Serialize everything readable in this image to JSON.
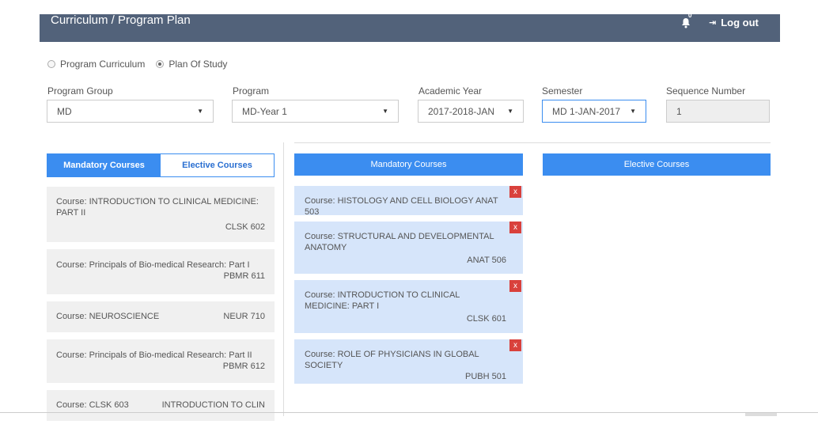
{
  "header": {
    "title": "Curriculum / Program Plan",
    "notification_count": "0",
    "logout_label": "Log out"
  },
  "view_mode": {
    "options": [
      {
        "label": "Program Curriculum",
        "selected": false
      },
      {
        "label": "Plan Of Study",
        "selected": true
      }
    ]
  },
  "filters": {
    "program_group": {
      "label": "Program Group",
      "value": "MD"
    },
    "program": {
      "label": "Program",
      "value": "MD-Year 1"
    },
    "academic_year": {
      "label": "Academic Year",
      "value": "2017-2018-JAN"
    },
    "semester": {
      "label": "Semester",
      "value": "MD 1-JAN-2017"
    },
    "sequence_number": {
      "label": "Sequence Number",
      "value": "1"
    }
  },
  "catalog": {
    "tabs": [
      {
        "label": "Mandatory Courses",
        "active": true
      },
      {
        "label": "Elective Courses",
        "active": false
      }
    ],
    "courses": [
      {
        "name": "Course: INTRODUCTION TO CLINICAL MEDICINE: PART II",
        "code": "CLSK 602"
      },
      {
        "name": "Course: Principals of Bio-medical Research: Part I",
        "code": "PBMR 611"
      },
      {
        "name": "Course: NEUROSCIENCE",
        "code": "NEUR 710"
      },
      {
        "name": "Course: Principals of Bio-medical Research: Part II",
        "code": "PBMR 612"
      },
      {
        "name": "Course: CLSK 603",
        "code": "INTRODUCTION TO CLIN"
      }
    ]
  },
  "plan": {
    "mandatory_header": "Mandatory Courses",
    "elective_header": "Elective Courses",
    "remove_label": "x",
    "mandatory_courses": [
      {
        "name": "Course: HISTOLOGY AND CELL BIOLOGY ANAT 503",
        "code": ""
      },
      {
        "name": "Course: STRUCTURAL AND DEVELOPMENTAL ANATOMY",
        "code": "ANAT 506"
      },
      {
        "name": "Course: INTRODUCTION TO CLINICAL MEDICINE: PART I",
        "code": "CLSK 601"
      },
      {
        "name": "Course: ROLE OF PHYSICIANS IN GLOBAL SOCIETY",
        "code": "PUBH 501"
      }
    ]
  },
  "colors": {
    "header_bg": "#52627a",
    "accent": "#3b8df0",
    "remove": "#d9413c",
    "plan_card": "#d6e5fa",
    "catalog_card": "#f0f0f0"
  }
}
